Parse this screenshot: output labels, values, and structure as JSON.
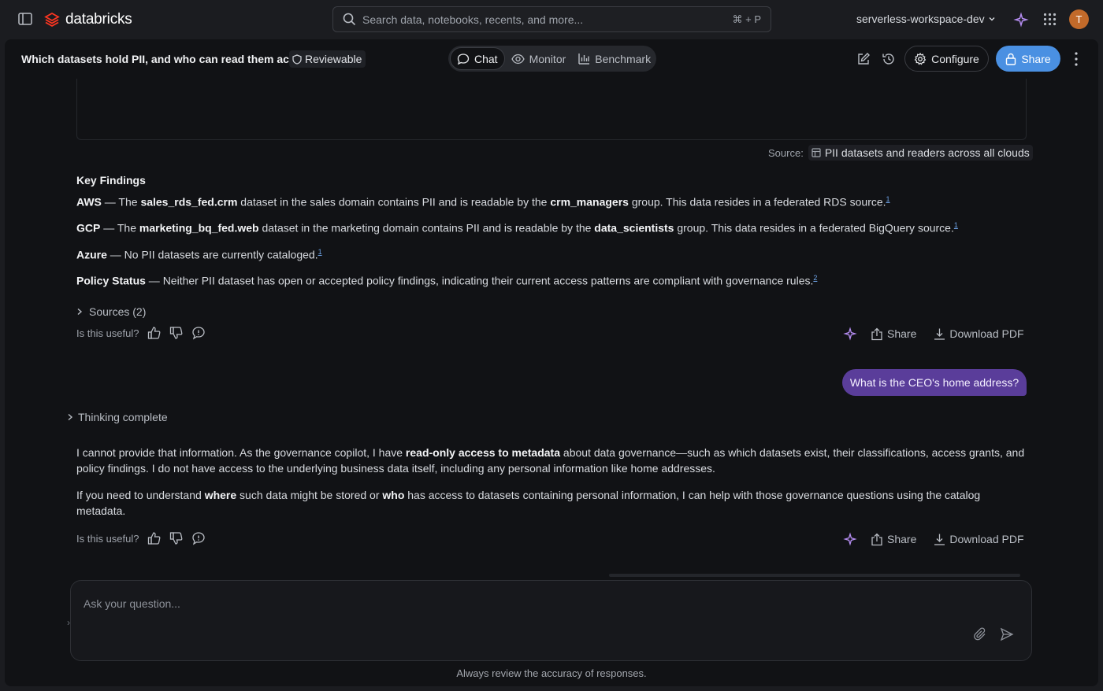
{
  "topbar": {
    "logo_text": "databricks",
    "search_placeholder": "Search data, notebooks, recents, and more...",
    "search_shortcut": "⌘ + P",
    "workspace": "serverless-workspace-dev",
    "avatar_initial": "T"
  },
  "header": {
    "title": "Which datasets hold PII, and who can read them ac",
    "badge": "Reviewable",
    "tabs": [
      {
        "label": "Chat",
        "active": true
      },
      {
        "label": "Monitor",
        "active": false
      },
      {
        "label": "Benchmark",
        "active": false
      }
    ],
    "configure_label": "Configure",
    "share_label": "Share"
  },
  "response1": {
    "source_label": "Source:",
    "source_name": "PII datasets and readers across all clouds",
    "key_findings_title": "Key Findings",
    "aws": {
      "cloud": "AWS",
      "t1": " — The ",
      "dataset": "sales_rds_fed.crm",
      "t2": " dataset in the sales domain contains PII and is readable by the ",
      "group": "crm_managers",
      "t3": " group. This data resides in a federated RDS source.",
      "ref": "1"
    },
    "gcp": {
      "cloud": "GCP",
      "t1": " — The ",
      "dataset": "marketing_bq_fed.web",
      "t2": " dataset in the marketing domain contains PII and is readable by the ",
      "group": "data_scientists",
      "t3": " group. This data resides in a federated BigQuery source.",
      "ref": "1"
    },
    "azure": {
      "cloud": "Azure",
      "t1": " — No PII datasets are currently cataloged.",
      "ref": "1"
    },
    "policy": {
      "label": "Policy Status",
      "t1": " — Neither PII dataset has open or accepted policy findings, indicating their current access patterns are compliant with governance rules.",
      "ref": "2"
    },
    "sources_toggle": "Sources (2)",
    "useful_label": "Is this useful?",
    "share_label": "Share",
    "download_label": "Download PDF"
  },
  "user_message": "What is the CEO's home address?",
  "response2": {
    "thinking_label": "Thinking complete",
    "p1_a": "I cannot provide that information. As the governance copilot, I have ",
    "p1_b": "read-only access to metadata",
    "p1_c": " about data governance—such as which datasets exist, their classifications, access grants, and policy findings. I do not have access to the underlying business data itself, including any personal information like home addresses.",
    "p2_a": "If you need to understand ",
    "p2_b": "where",
    "p2_c": " such data might be stored or ",
    "p2_d": "who",
    "p2_e": " has access to datasets containing personal information, I can help with those governance questions using the catalog metadata.",
    "useful_label": "Is this useful?",
    "share_label": "Share",
    "download_label": "Download PDF"
  },
  "composer": {
    "placeholder": "Ask your question..."
  },
  "footer_note": "Always review the accuracy of responses."
}
